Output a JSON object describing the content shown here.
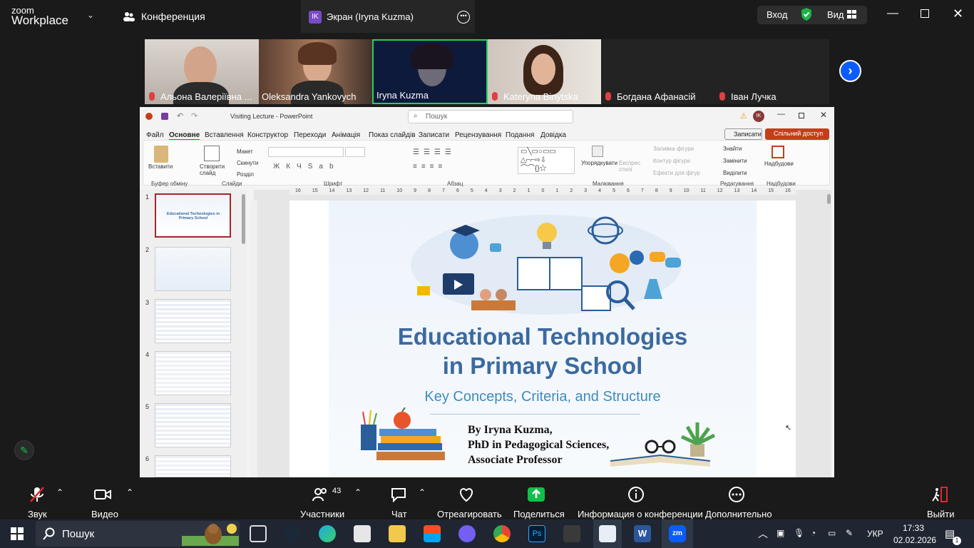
{
  "topbar": {
    "logo_top": "zoom",
    "logo_bottom": "Workplace",
    "conference_label": "Конференция",
    "screen_badge": "IK",
    "screen_label": "Экран (Iryna Kuzma)",
    "login": "Вход",
    "view": "Вид",
    "more_icon": "ellipsis-icon"
  },
  "participants": [
    {
      "name": "Альона Валеріївна ...",
      "muted": true
    },
    {
      "name": "Oleksandra Yankovych",
      "muted": false
    },
    {
      "name": "Iryna Kuzma",
      "muted": false,
      "active_speaker": true
    },
    {
      "name": "Kateryna Binytska",
      "muted": true
    },
    {
      "name": "Богдана Афанасій",
      "muted": true
    },
    {
      "name": "Іван Лучка",
      "muted": true
    }
  ],
  "ppt": {
    "title": "Visiting Lecture  -  PowerPoint",
    "search_placeholder": "Пошук",
    "avatar": "IK",
    "record_btn": "Записати",
    "share_btn": "Спільний доступ",
    "menu": [
      "Файл",
      "Основне",
      "Вставлення",
      "Конструктор",
      "Переходи",
      "Анімація",
      "Показ слайдів",
      "Записати",
      "Рецензування",
      "Подання",
      "Довідка"
    ],
    "active_menu": "Основне",
    "ribbon": {
      "paste": "Вставити",
      "new_slide": "Створити слайд",
      "layout": "Макет",
      "reset": "Скинути",
      "section": "Розділ",
      "arrange": "Упорядкувати",
      "express": "Експрес стилі",
      "fill": "Заливка фігури",
      "outline": "Контур фігури",
      "effects": "Ефекти для фігур",
      "find": "Знайти",
      "replace": "Замінити",
      "select": "Виділити",
      "addins": "Надбудови",
      "groups": [
        "Буфер обміну",
        "Слайди",
        "Шрифт",
        "Абзац",
        "Малювання",
        "Редагування",
        "Надбудови"
      ]
    },
    "slide_numbers": [
      "1",
      "2",
      "3",
      "4",
      "5",
      "6"
    ],
    "ruler_labels": [
      "16",
      "15",
      "14",
      "13",
      "12",
      "11",
      "10",
      "9",
      "8",
      "7",
      "6",
      "5",
      "4",
      "3",
      "2",
      "1",
      "0",
      "1",
      "2",
      "3",
      "4",
      "5",
      "6",
      "7",
      "8",
      "9",
      "10",
      "11",
      "12",
      "13",
      "14",
      "15",
      "16"
    ],
    "thumb1_title": "Educational Technologies in Primary School",
    "slide": {
      "title_line1": "Educational Technologies",
      "title_line2": "in Primary School",
      "subtitle": "Key Concepts, Criteria, and Structure",
      "author_line1": "By Iryna Kuzma,",
      "author_line2": "PhD in Pedagogical Sciences,",
      "author_line3": "Associate Professor"
    }
  },
  "controls": {
    "audio": "Звук",
    "video": "Видео",
    "participants": "Участники",
    "participants_count": "43",
    "chat": "Чат",
    "react": "Отреагировать",
    "share": "Поделиться",
    "info": "Информация о конференции",
    "more": "Дополнительно",
    "leave": "Выйти"
  },
  "taskbar": {
    "search": "Пошук",
    "lang": "УКР",
    "time": "17:33",
    "date": "02.02.2026",
    "notifications": "1"
  },
  "colors": {
    "accent": "#0b5cff",
    "share_green": "#10c04a",
    "ppt_red": "#c43e1c",
    "slide_title": "#3b6aa0"
  }
}
